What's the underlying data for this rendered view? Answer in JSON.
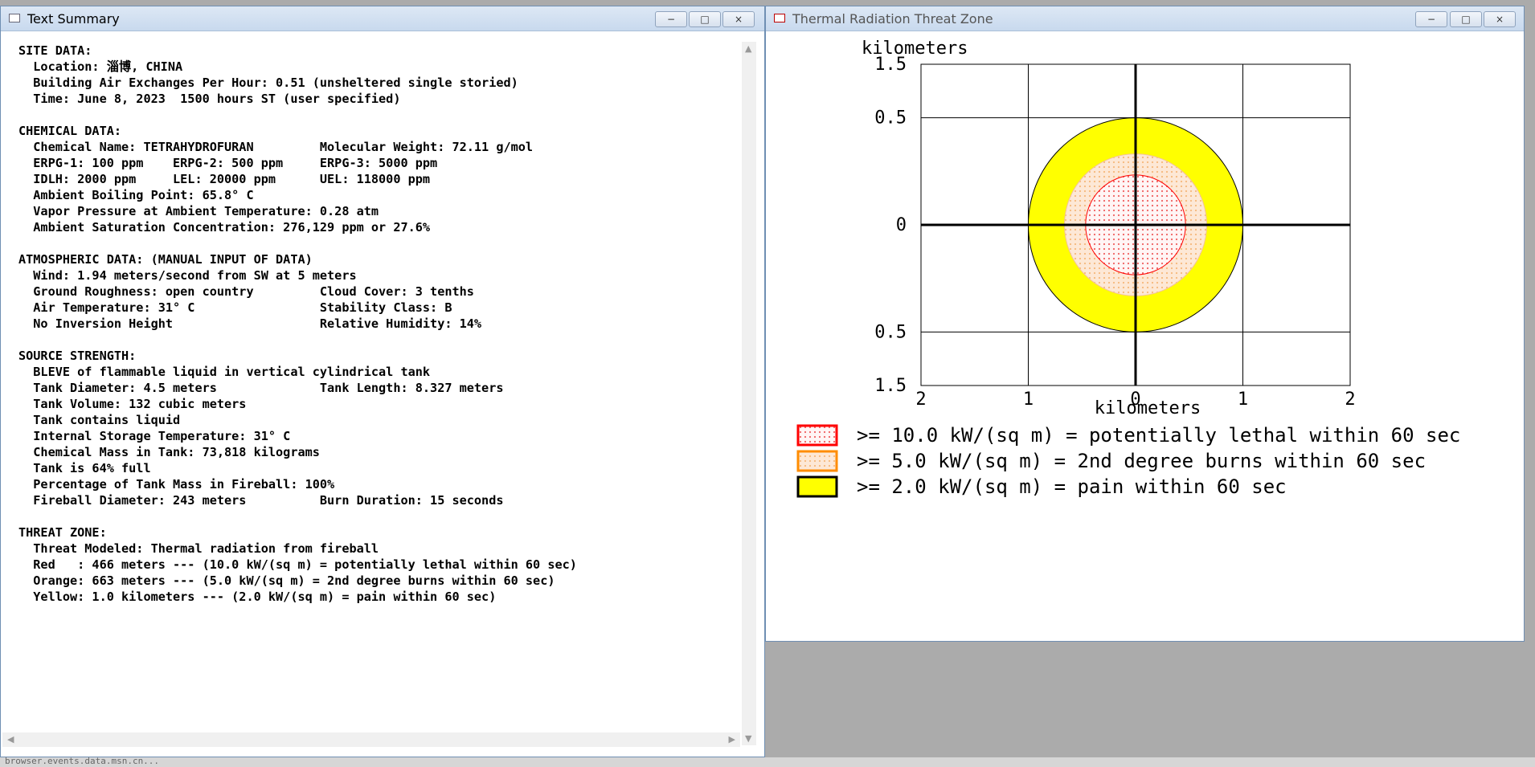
{
  "text_window": {
    "title": "Text Summary",
    "minimize": "−",
    "maximize": "□",
    "close": "×",
    "lines": [
      "SITE DATA:",
      "  Location: 淄博, CHINA",
      "  Building Air Exchanges Per Hour: 0.51 (unsheltered single storied)",
      "  Time: June 8, 2023  1500 hours ST (user specified)",
      "",
      "CHEMICAL DATA:",
      "  Chemical Name: TETRAHYDROFURAN         Molecular Weight: 72.11 g/mol",
      "  ERPG-1: 100 ppm    ERPG-2: 500 ppm     ERPG-3: 5000 ppm",
      "  IDLH: 2000 ppm     LEL: 20000 ppm      UEL: 118000 ppm",
      "  Ambient Boiling Point: 65.8° C",
      "  Vapor Pressure at Ambient Temperature: 0.28 atm",
      "  Ambient Saturation Concentration: 276,129 ppm or 27.6%",
      "",
      "ATMOSPHERIC DATA: (MANUAL INPUT OF DATA)",
      "  Wind: 1.94 meters/second from SW at 5 meters",
      "  Ground Roughness: open country         Cloud Cover: 3 tenths",
      "  Air Temperature: 31° C                 Stability Class: B",
      "  No Inversion Height                    Relative Humidity: 14%",
      "",
      "SOURCE STRENGTH:",
      "  BLEVE of flammable liquid in vertical cylindrical tank",
      "  Tank Diameter: 4.5 meters              Tank Length: 8.327 meters",
      "  Tank Volume: 132 cubic meters",
      "  Tank contains liquid",
      "  Internal Storage Temperature: 31° C",
      "  Chemical Mass in Tank: 73,818 kilograms",
      "  Tank is 64% full",
      "  Percentage of Tank Mass in Fireball: 100%",
      "  Fireball Diameter: 243 meters          Burn Duration: 15 seconds",
      "",
      "THREAT ZONE:",
      "  Threat Modeled: Thermal radiation from fireball",
      "  Red   : 466 meters --- (10.0 kW/(sq m) = potentially lethal within 60 sec)",
      "  Orange: 663 meters --- (5.0 kW/(sq m) = 2nd degree burns within 60 sec)",
      "  Yellow: 1.0 kilometers --- (2.0 kW/(sq m) = pain within 60 sec)"
    ]
  },
  "threat_window": {
    "title": "Thermal Radiation Threat Zone",
    "minimize": "−",
    "maximize": "□",
    "close": "×"
  },
  "chart_data": {
    "type": "area",
    "ylabel": "kilometers",
    "xlabel": "kilometers",
    "xlim": [
      -2,
      2
    ],
    "ylim": [
      -1.5,
      1.5
    ],
    "x_ticks": [
      "2",
      "1",
      "0",
      "1",
      "2"
    ],
    "y_ticks": [
      "1.5",
      "0.5",
      "0",
      "0.5",
      "1.5"
    ],
    "grid": true,
    "zones": [
      {
        "name": "Red",
        "radius_km": 0.466,
        "color": "#ff0000",
        "legend": ">= 10.0 kW/(sq m) = potentially lethal within 60 sec"
      },
      {
        "name": "Orange",
        "radius_km": 0.663,
        "color": "#ff8c00",
        "legend": ">= 5.0 kW/(sq m) = 2nd degree burns within 60 sec"
      },
      {
        "name": "Yellow",
        "radius_km": 1.0,
        "color": "#ffff00",
        "legend": ">= 2.0 kW/(sq m) = pain within 60 sec"
      }
    ]
  },
  "status_text": "browser.events.data.msn.cn..."
}
